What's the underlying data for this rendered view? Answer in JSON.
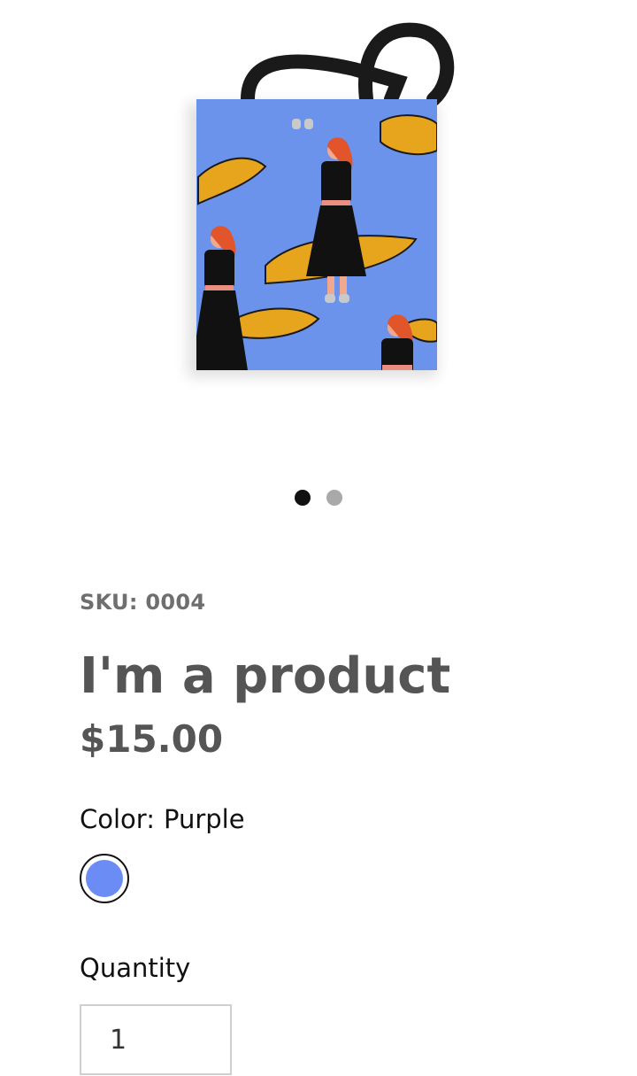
{
  "product": {
    "sku_label": "SKU:",
    "sku_value": "0004",
    "title": "I'm a product",
    "price": "$15.00",
    "bag_color": "#6b93ec",
    "handle_color": "#1a1a1a"
  },
  "gallery": {
    "total_images": 2,
    "active_index": 0
  },
  "options": {
    "color_label": "Color:",
    "color_value": "Purple",
    "swatch_color": "#6b8cf5",
    "quantity_label": "Quantity",
    "quantity_value": "1"
  }
}
